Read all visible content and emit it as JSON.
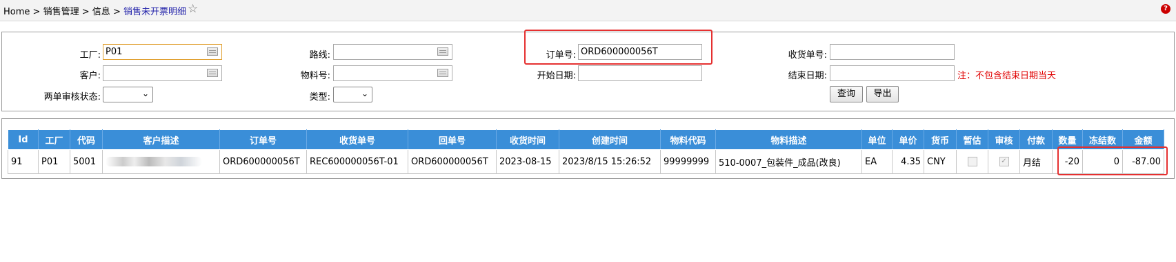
{
  "breadcrumb": {
    "items": [
      "Home",
      ">",
      "销售管理",
      ">",
      "信息",
      ">"
    ],
    "current": "销售未开票明细"
  },
  "filters": {
    "factory_label": "工厂:",
    "factory_value": "P01",
    "route_label": "路线:",
    "route_value": "",
    "order_label": "订单号:",
    "order_value": "ORD600000056T",
    "receipt_label": "收货单号:",
    "receipt_value": "",
    "customer_label": "客户:",
    "customer_value": "",
    "material_label": "物料号:",
    "material_value": "",
    "start_label": "开始日期:",
    "start_value": "",
    "end_label": "结束日期:",
    "end_value": "",
    "end_note": "注：不包含结束日期当天",
    "audit_label": "两单审核状态:",
    "audit_value": "",
    "type_label": "类型:",
    "type_value": "",
    "query_button": "查询",
    "export_button": "导出"
  },
  "table": {
    "columns": [
      "Id",
      "工厂",
      "代码",
      "客户描述",
      "订单号",
      "收货单号",
      "回单号",
      "收货时间",
      "创建时间",
      "物料代码",
      "物料描述",
      "单位",
      "单价",
      "货币",
      "暂估",
      "审核",
      "付款",
      "数量",
      "冻结数",
      "金额"
    ],
    "rows": [
      {
        "id": "91",
        "factory": "P01",
        "code": "5001",
        "customer": "",
        "order": "ORD600000056T",
        "receipt": "REC600000056T-01",
        "return_no": "ORD600000056T",
        "receive_time": "2023-08-15",
        "create_time": "2023/8/15 15:26:52",
        "material_code": "99999999",
        "material_desc": "510-0007_包装件_成品(改良)",
        "unit": "EA",
        "price": "4.35",
        "currency": "CNY",
        "provisional": false,
        "audited": true,
        "payment": "月结",
        "qty": "-20",
        "frozen": "0",
        "amount": "-87.00"
      }
    ]
  },
  "colors": {
    "header_bg": "#3a8ed8",
    "highlight": "#e53030",
    "note": "#e00000"
  }
}
